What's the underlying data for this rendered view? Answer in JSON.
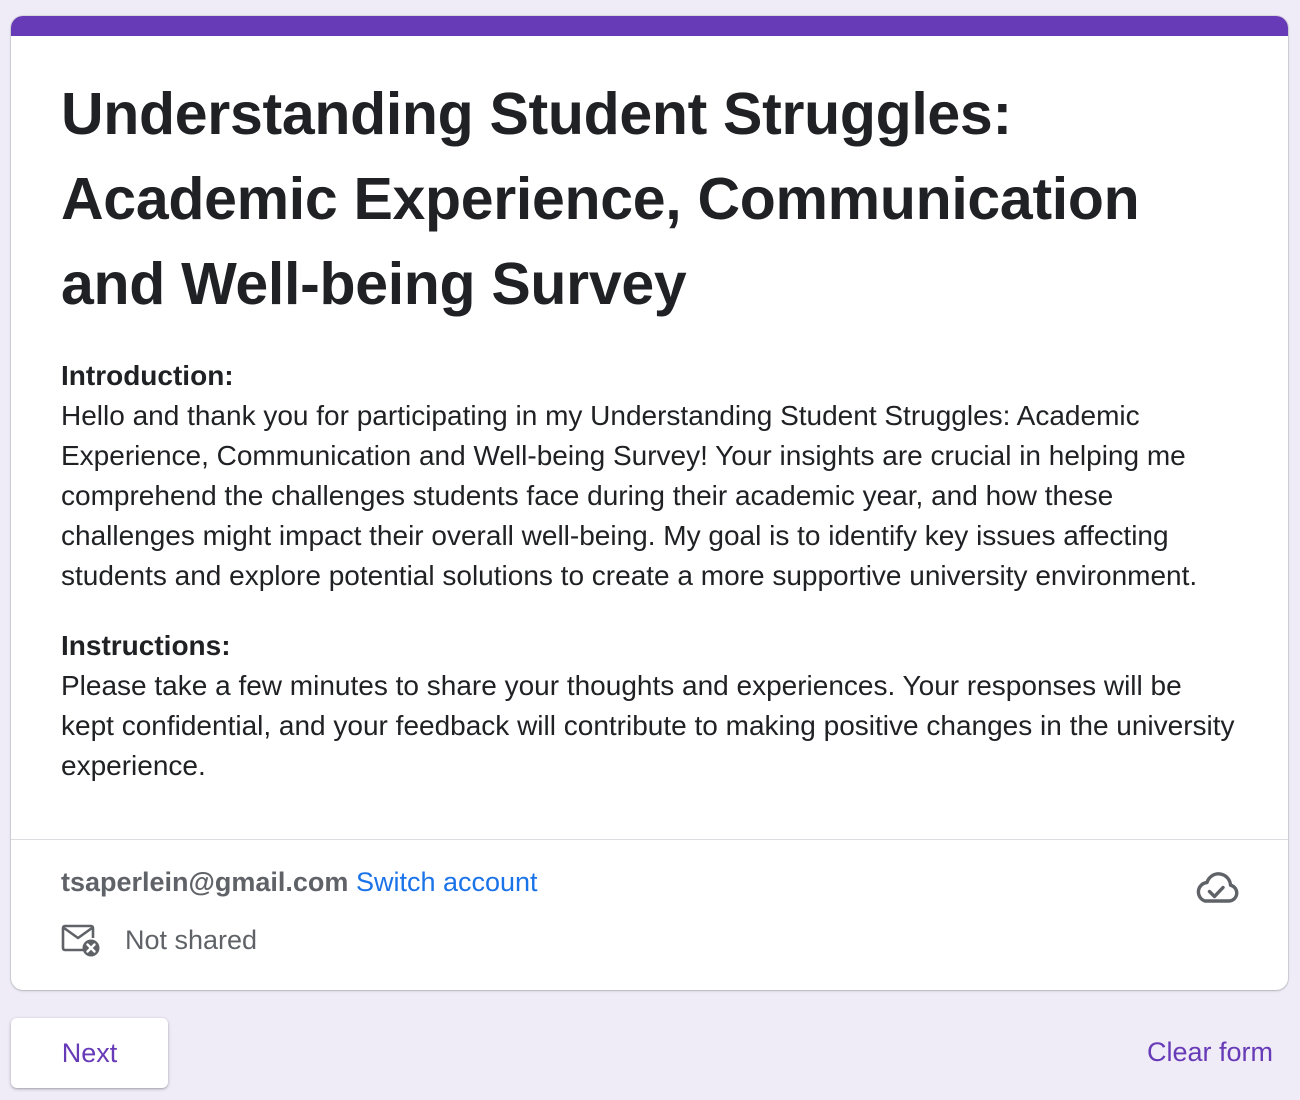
{
  "form": {
    "title": "Understanding Student Struggles: Academic Experience, Communication and Well-being Survey",
    "accent_color": "#673ab7",
    "background_color": "#efebf7",
    "sections": [
      {
        "heading": "Introduction:",
        "text": "Hello and thank you for participating in my Understanding Student Struggles: Academic Experience, Communication and Well-being Survey! Your insights are crucial in helping me comprehend the challenges students face during their academic year, and how these challenges might impact their overall well-being. My goal is to identify key issues affecting students and explore potential solutions to create a more supportive university environment."
      },
      {
        "heading": "Instructions:",
        "text": "Please take a few minutes to share your thoughts and experiences. Your responses will be kept confidential, and your feedback will contribute to making positive changes in the university experience."
      }
    ]
  },
  "account": {
    "email": "tsaperlein@gmail.com",
    "switch_label": "Switch account",
    "switch_color": "#1a73e8",
    "sharing_status": "Not shared",
    "sharing_icon": "mail-x-icon",
    "save_status_icon": "cloud-done-icon"
  },
  "footer": {
    "next_label": "Next",
    "clear_label": "Clear form"
  }
}
